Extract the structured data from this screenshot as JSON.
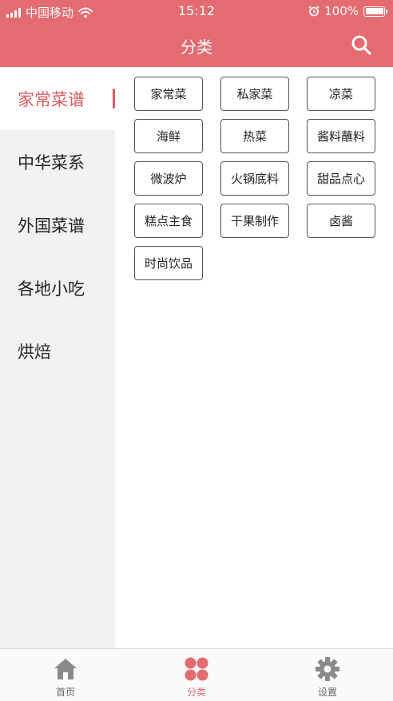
{
  "status_bar": {
    "carrier": "中国移动",
    "time": "15:12",
    "battery": "100%"
  },
  "header": {
    "title": "分类"
  },
  "sidebar": {
    "items": [
      {
        "label": "家常菜谱",
        "active": true
      },
      {
        "label": "中华菜系",
        "active": false
      },
      {
        "label": "外国菜谱",
        "active": false
      },
      {
        "label": "各地小吃",
        "active": false
      },
      {
        "label": "烘焙",
        "active": false
      }
    ]
  },
  "tags": [
    "家常菜",
    "私家菜",
    "凉菜",
    "海鲜",
    "热菜",
    "酱料蘸料",
    "微波炉",
    "火锅底料",
    "甜品点心",
    "糕点主食",
    "干果制作",
    "卤酱",
    "时尚饮品"
  ],
  "tabbar": {
    "items": [
      {
        "label": "首页",
        "icon": "home-icon"
      },
      {
        "label": "分类",
        "icon": "grid-icon",
        "active": true
      },
      {
        "label": "设置",
        "icon": "gear-icon"
      }
    ]
  },
  "colors": {
    "accent": "#e46b70",
    "active_text": "#e05a5f",
    "sidebar_bg": "#f2f2f2",
    "icon_gray": "#8a8a8a"
  }
}
